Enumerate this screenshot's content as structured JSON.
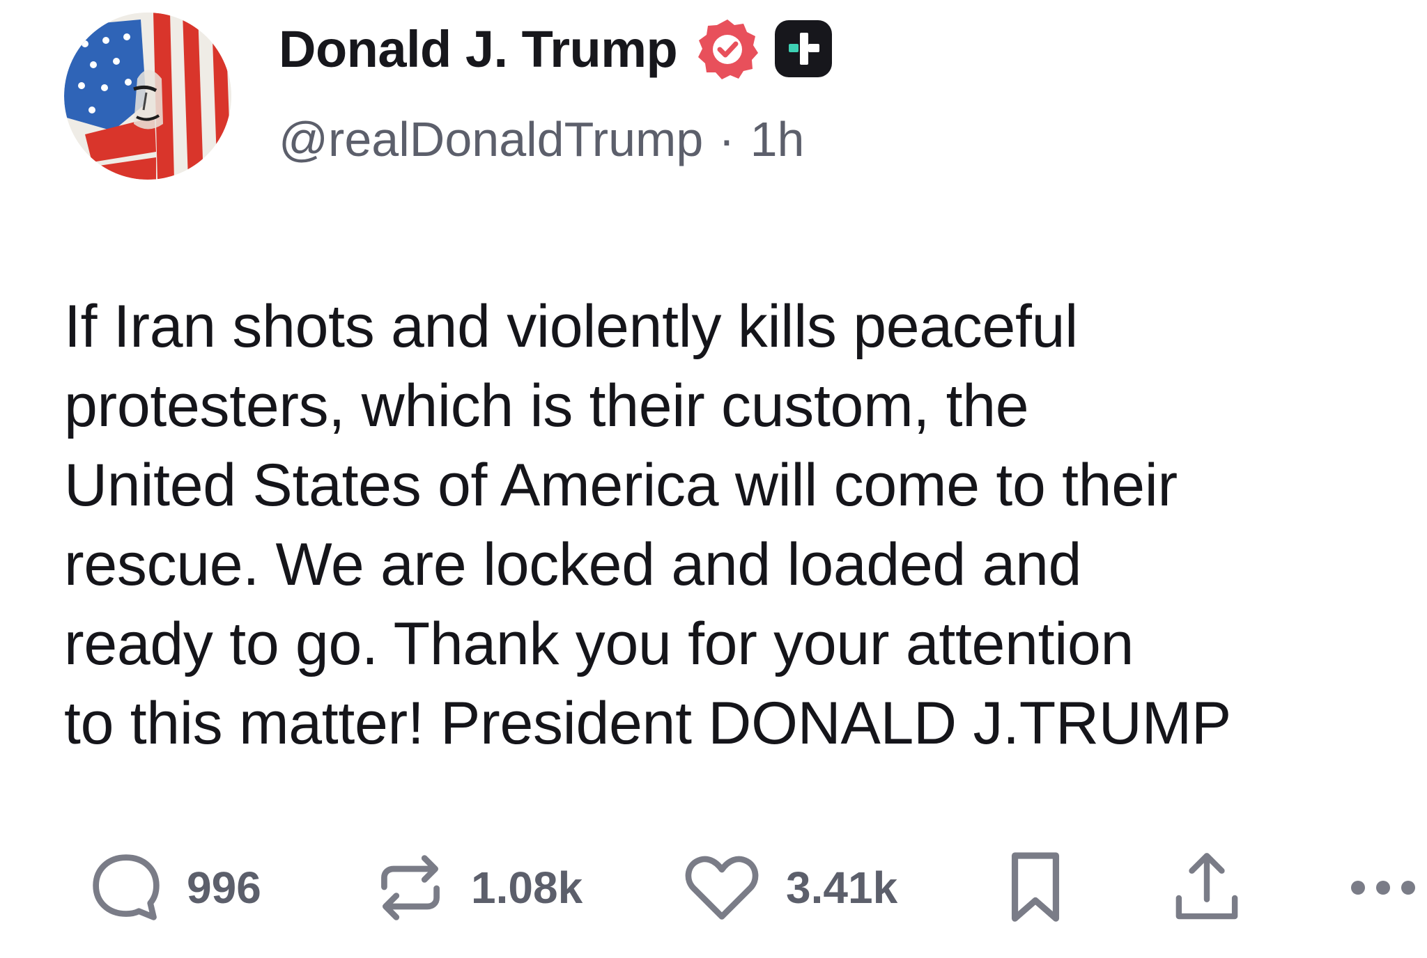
{
  "author": {
    "display_name": "Donald J. Trump",
    "handle": "@realDonaldTrump",
    "separator": "·",
    "timestamp": "1h",
    "verified_icon": "verified-check-icon",
    "plus_icon": "plus-badge-icon"
  },
  "post": {
    "text": "If Iran shots and violently kills peaceful\nprotesters, which is their custom, the\nUnited States of America will come to their\nrescue. We are locked and loaded and\nready to go. Thank you for your attention\nto this matter! President DONALD J.TRUMP"
  },
  "actions": {
    "reply": {
      "icon": "comment-icon",
      "count": "996"
    },
    "repost": {
      "icon": "repost-icon",
      "count": "1.08k"
    },
    "like": {
      "icon": "heart-icon",
      "count": "3.41k"
    },
    "bookmark": {
      "icon": "bookmark-icon"
    },
    "share": {
      "icon": "share-icon"
    },
    "more": {
      "icon": "more-icon"
    }
  },
  "colors": {
    "text": "#15151a",
    "secondary": "#5c5f6b",
    "icon": "#7a7c87",
    "verified": "#e8505b",
    "plus_badge_bg": "#17171c",
    "plus_badge_accent": "#3ed1b4"
  }
}
